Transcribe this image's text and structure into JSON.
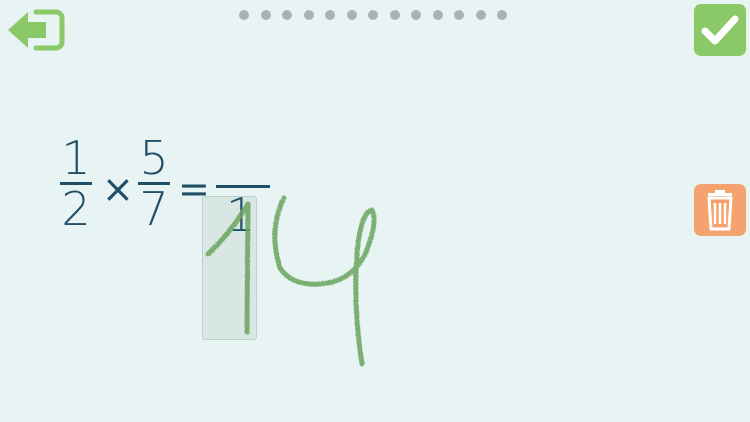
{
  "navigation": {
    "back_icon": "arrow-left-exit-icon",
    "progress_total": 13,
    "progress_current": 0
  },
  "actions": {
    "check_icon": "checkmark-icon",
    "trash_icon": "trash-icon",
    "check_color": "#8bc867",
    "trash_color": "#f4a36f"
  },
  "problem": {
    "fraction1": {
      "numerator": "1",
      "denominator": "2"
    },
    "operator": "×",
    "fraction2": {
      "numerator": "5",
      "denominator": "7"
    },
    "equals": "=",
    "answer_numerator_shown": "1",
    "handwritten_denominator": "14"
  },
  "colors": {
    "background": "#e8f4f4",
    "ink": "#6aa35b",
    "text": "#1f4f66"
  }
}
